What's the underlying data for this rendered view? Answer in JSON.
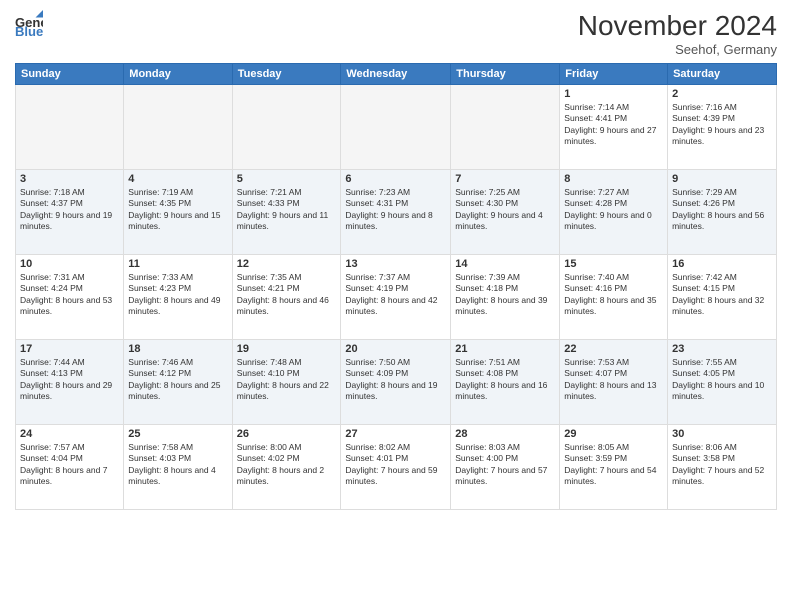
{
  "header": {
    "logo_line1": "General",
    "logo_line2": "Blue",
    "month_title": "November 2024",
    "subtitle": "Seehof, Germany"
  },
  "days_of_week": [
    "Sunday",
    "Monday",
    "Tuesday",
    "Wednesday",
    "Thursday",
    "Friday",
    "Saturday"
  ],
  "weeks": [
    [
      {
        "day": "",
        "info": ""
      },
      {
        "day": "",
        "info": ""
      },
      {
        "day": "",
        "info": ""
      },
      {
        "day": "",
        "info": ""
      },
      {
        "day": "",
        "info": ""
      },
      {
        "day": "1",
        "info": "Sunrise: 7:14 AM\nSunset: 4:41 PM\nDaylight: 9 hours and 27 minutes."
      },
      {
        "day": "2",
        "info": "Sunrise: 7:16 AM\nSunset: 4:39 PM\nDaylight: 9 hours and 23 minutes."
      }
    ],
    [
      {
        "day": "3",
        "info": "Sunrise: 7:18 AM\nSunset: 4:37 PM\nDaylight: 9 hours and 19 minutes."
      },
      {
        "day": "4",
        "info": "Sunrise: 7:19 AM\nSunset: 4:35 PM\nDaylight: 9 hours and 15 minutes."
      },
      {
        "day": "5",
        "info": "Sunrise: 7:21 AM\nSunset: 4:33 PM\nDaylight: 9 hours and 11 minutes."
      },
      {
        "day": "6",
        "info": "Sunrise: 7:23 AM\nSunset: 4:31 PM\nDaylight: 9 hours and 8 minutes."
      },
      {
        "day": "7",
        "info": "Sunrise: 7:25 AM\nSunset: 4:30 PM\nDaylight: 9 hours and 4 minutes."
      },
      {
        "day": "8",
        "info": "Sunrise: 7:27 AM\nSunset: 4:28 PM\nDaylight: 9 hours and 0 minutes."
      },
      {
        "day": "9",
        "info": "Sunrise: 7:29 AM\nSunset: 4:26 PM\nDaylight: 8 hours and 56 minutes."
      }
    ],
    [
      {
        "day": "10",
        "info": "Sunrise: 7:31 AM\nSunset: 4:24 PM\nDaylight: 8 hours and 53 minutes."
      },
      {
        "day": "11",
        "info": "Sunrise: 7:33 AM\nSunset: 4:23 PM\nDaylight: 8 hours and 49 minutes."
      },
      {
        "day": "12",
        "info": "Sunrise: 7:35 AM\nSunset: 4:21 PM\nDaylight: 8 hours and 46 minutes."
      },
      {
        "day": "13",
        "info": "Sunrise: 7:37 AM\nSunset: 4:19 PM\nDaylight: 8 hours and 42 minutes."
      },
      {
        "day": "14",
        "info": "Sunrise: 7:39 AM\nSunset: 4:18 PM\nDaylight: 8 hours and 39 minutes."
      },
      {
        "day": "15",
        "info": "Sunrise: 7:40 AM\nSunset: 4:16 PM\nDaylight: 8 hours and 35 minutes."
      },
      {
        "day": "16",
        "info": "Sunrise: 7:42 AM\nSunset: 4:15 PM\nDaylight: 8 hours and 32 minutes."
      }
    ],
    [
      {
        "day": "17",
        "info": "Sunrise: 7:44 AM\nSunset: 4:13 PM\nDaylight: 8 hours and 29 minutes."
      },
      {
        "day": "18",
        "info": "Sunrise: 7:46 AM\nSunset: 4:12 PM\nDaylight: 8 hours and 25 minutes."
      },
      {
        "day": "19",
        "info": "Sunrise: 7:48 AM\nSunset: 4:10 PM\nDaylight: 8 hours and 22 minutes."
      },
      {
        "day": "20",
        "info": "Sunrise: 7:50 AM\nSunset: 4:09 PM\nDaylight: 8 hours and 19 minutes."
      },
      {
        "day": "21",
        "info": "Sunrise: 7:51 AM\nSunset: 4:08 PM\nDaylight: 8 hours and 16 minutes."
      },
      {
        "day": "22",
        "info": "Sunrise: 7:53 AM\nSunset: 4:07 PM\nDaylight: 8 hours and 13 minutes."
      },
      {
        "day": "23",
        "info": "Sunrise: 7:55 AM\nSunset: 4:05 PM\nDaylight: 8 hours and 10 minutes."
      }
    ],
    [
      {
        "day": "24",
        "info": "Sunrise: 7:57 AM\nSunset: 4:04 PM\nDaylight: 8 hours and 7 minutes."
      },
      {
        "day": "25",
        "info": "Sunrise: 7:58 AM\nSunset: 4:03 PM\nDaylight: 8 hours and 4 minutes."
      },
      {
        "day": "26",
        "info": "Sunrise: 8:00 AM\nSunset: 4:02 PM\nDaylight: 8 hours and 2 minutes."
      },
      {
        "day": "27",
        "info": "Sunrise: 8:02 AM\nSunset: 4:01 PM\nDaylight: 7 hours and 59 minutes."
      },
      {
        "day": "28",
        "info": "Sunrise: 8:03 AM\nSunset: 4:00 PM\nDaylight: 7 hours and 57 minutes."
      },
      {
        "day": "29",
        "info": "Sunrise: 8:05 AM\nSunset: 3:59 PM\nDaylight: 7 hours and 54 minutes."
      },
      {
        "day": "30",
        "info": "Sunrise: 8:06 AM\nSunset: 3:58 PM\nDaylight: 7 hours and 52 minutes."
      }
    ]
  ]
}
